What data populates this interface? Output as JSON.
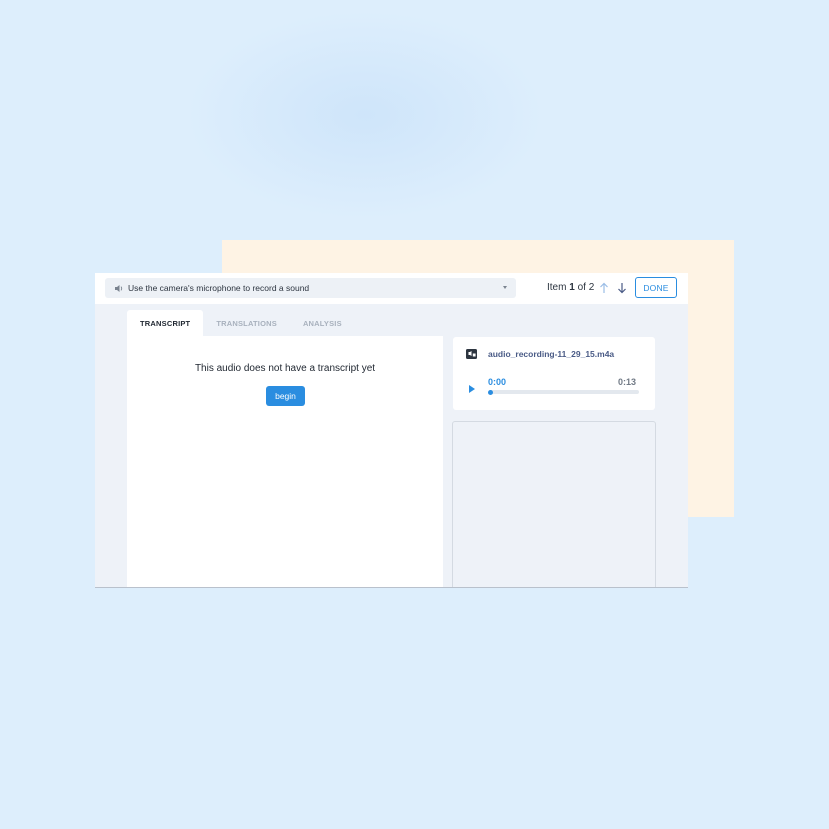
{
  "header": {
    "question_label": "Use the camera's microphone to record a sound",
    "item_prefix": "Item",
    "item_current": "1",
    "item_of": "of",
    "item_total": "2",
    "done_label": "DONE"
  },
  "tabs": [
    {
      "label": "TRANSCRIPT",
      "active": true
    },
    {
      "label": "TRANSLATIONS",
      "active": false
    },
    {
      "label": "ANALYSIS",
      "active": false
    }
  ],
  "transcript": {
    "empty_message": "This audio does not have a transcript yet",
    "begin_label": "begin"
  },
  "audio": {
    "file_name": "audio_recording-11_29_15.m4a",
    "current_time": "0:00",
    "duration": "0:13",
    "progress": 0
  },
  "colors": {
    "accent": "#2a8de0",
    "background": "#ddeefc",
    "peach": "#fef3e4",
    "panel": "#eef2f8",
    "filename": "#4a5b86"
  },
  "icons": {
    "question": "speaker-icon",
    "dropdown": "chevron-down-icon",
    "prev": "arrow-up-icon",
    "next": "arrow-down-icon",
    "file": "file-audio-icon",
    "play": "play-icon"
  }
}
